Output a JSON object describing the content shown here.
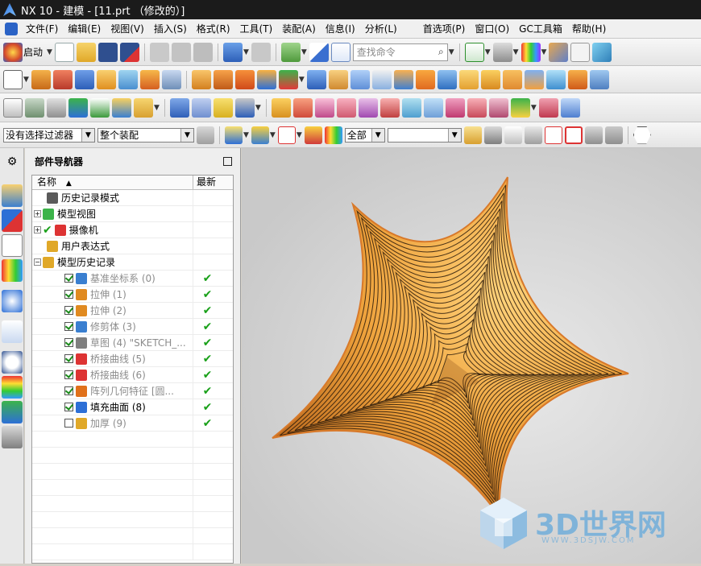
{
  "window": {
    "title": "NX 10 - 建模 - [11.prt （修改的）]"
  },
  "menu": [
    "文件(F)",
    "编辑(E)",
    "视图(V)",
    "插入(S)",
    "格式(R)",
    "工具(T)",
    "装配(A)",
    "信息(I)",
    "分析(L)",
    "首选项(P)",
    "窗口(O)",
    "GC工具箱",
    "帮助(H)"
  ],
  "toolbar": {
    "start_label": "启动",
    "search_placeholder": "查找命令"
  },
  "selbar": {
    "filter": "没有选择过滤器",
    "scope": "整个装配",
    "all": "全部",
    "blank": ""
  },
  "navigator": {
    "title": "部件导航器",
    "col_name": "名称",
    "col_latest": "最新",
    "rows": [
      {
        "label": "历史记录模式",
        "check": false,
        "tick": false,
        "grey": false
      },
      {
        "label": "模型视图",
        "check": false,
        "tick": false,
        "grey": false
      },
      {
        "label": "摄像机",
        "check": false,
        "tick": false,
        "grey": false
      },
      {
        "label": "用户表达式",
        "check": false,
        "tick": false,
        "grey": false
      },
      {
        "label": "模型历史记录",
        "check": false,
        "tick": false,
        "grey": false
      },
      {
        "label": "基准坐标系 (0)",
        "check": true,
        "tick": true,
        "grey": true
      },
      {
        "label": "拉伸 (1)",
        "check": true,
        "tick": true,
        "grey": true
      },
      {
        "label": "拉伸 (2)",
        "check": true,
        "tick": true,
        "grey": true
      },
      {
        "label": "修剪体 (3)",
        "check": true,
        "tick": true,
        "grey": true
      },
      {
        "label": "草图 (4) \"SKETCH_...",
        "check": true,
        "tick": true,
        "grey": true
      },
      {
        "label": "桥接曲线 (5)",
        "check": true,
        "tick": true,
        "grey": true
      },
      {
        "label": "桥接曲线 (6)",
        "check": true,
        "tick": true,
        "grey": true
      },
      {
        "label": "阵列几何特征 [圆...",
        "check": true,
        "tick": true,
        "grey": true
      },
      {
        "label": "填充曲面 (8)",
        "check": true,
        "tick": true,
        "grey": false
      },
      {
        "label": "加厚 (9)",
        "check": false,
        "tick": true,
        "grey": true
      }
    ]
  },
  "watermark": {
    "brand": "3D世界网",
    "url": "WWW.3DSJW.COM"
  },
  "colors": {
    "surface": "#e8952f",
    "check": "#19a019",
    "viewport_bg": "#d6d6d6"
  }
}
